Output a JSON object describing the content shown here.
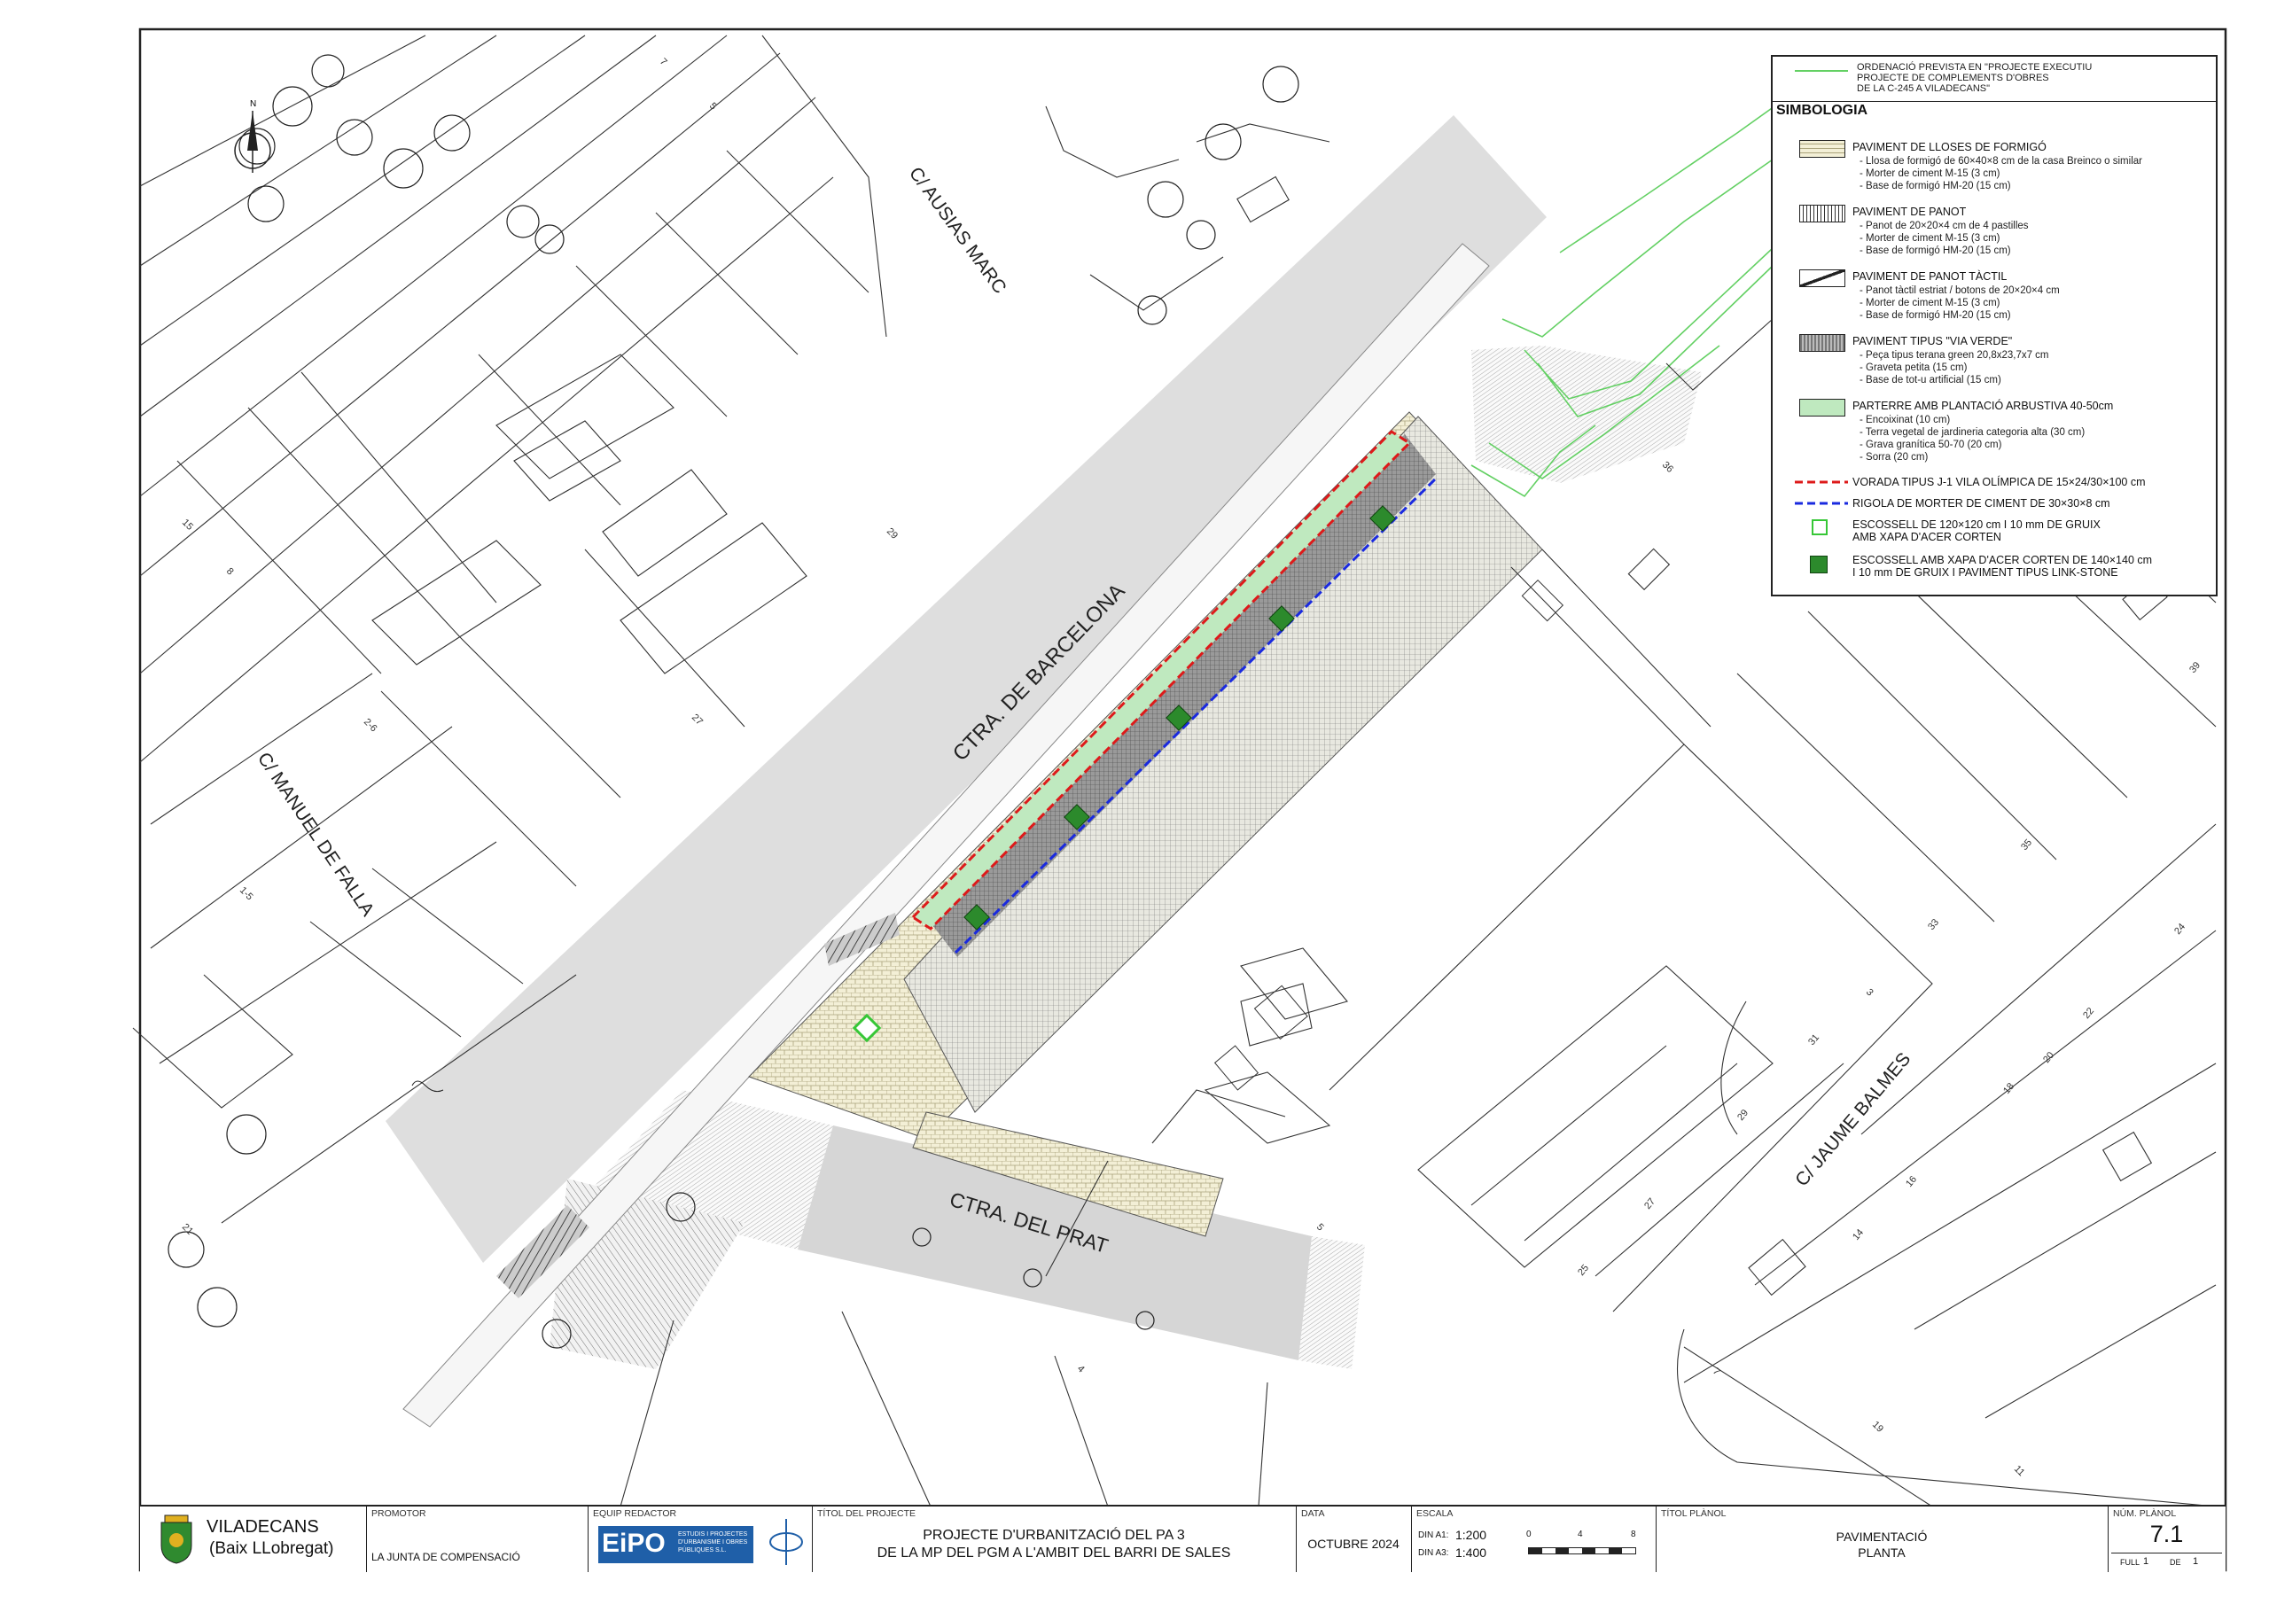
{
  "map": {
    "street_labels": [
      "C/ AUSIAS MARC",
      "CTRA. DE BARCELONA",
      "C/ MANUEL DE FALLA",
      "CTRA. DEL PRAT",
      "C/ JAUME BALMES"
    ],
    "lot_numbers": [
      "7",
      "5",
      "29",
      "15",
      "8",
      "2-6",
      "27",
      "1-5",
      "21",
      "4",
      "36",
      "39",
      "35",
      "33",
      "31",
      "24",
      "22",
      "20",
      "18",
      "16",
      "14",
      "29",
      "27",
      "25",
      "5",
      "3",
      "7",
      "11",
      "19"
    ],
    "north_symbol": "N"
  },
  "legend": {
    "header_note": [
      "ORDENACIÓ PREVISTA EN \"PROJECTE EXECUTIU",
      "PROJECTE DE COMPLEMENTS D'OBRES",
      "DE LA C-245 A VILADECANS\""
    ],
    "title": "SIMBOLOGIA",
    "items": [
      {
        "title": "PAVIMENT DE LLOSES DE FORMIGÓ",
        "details": [
          "- Llosa de formigó de 60×40×8 cm de la casa Breinco o similar",
          "- Morter de ciment M-15 (3 cm)",
          "- Base de formigó HM-20 (15 cm)"
        ],
        "icon": "lloses-swatch"
      },
      {
        "title": "PAVIMENT DE PANOT",
        "details": [
          "- Panot de 20×20×4 cm de 4 pastilles",
          "- Morter de ciment M-15 (3 cm)",
          "- Base de formigó HM-20 (15 cm)"
        ],
        "icon": "panot-swatch"
      },
      {
        "title": "PAVIMENT DE PANOT TÀCTIL",
        "details": [
          "- Panot tàctil estriat / botons de 20×20×4 cm",
          "- Morter de ciment M-15 (3 cm)",
          "- Base de formigó HM-20 (15 cm)"
        ],
        "icon": "tactil-swatch"
      },
      {
        "title": "PAVIMENT TIPUS \"VIA VERDE\"",
        "details": [
          "- Peça tipus terana green 20,8x23,7x7 cm",
          "- Graveta petita (15 cm)",
          "- Base de tot-u artificial (15 cm)"
        ],
        "icon": "via-verde-swatch"
      },
      {
        "title": "PARTERRE AMB PLANTACIÓ ARBUSTIVA 40-50cm",
        "details": [
          "- Encoixinat (10 cm)",
          "- Terra vegetal de jardineria categoria alta (30 cm)",
          "- Grava granítica 50-70 (20 cm)",
          "- Sorra (20 cm)"
        ],
        "icon": "parterre-swatch"
      }
    ],
    "line_items": [
      {
        "title": "VORADA TIPUS J-1 VILA OLÍMPICA DE 15×24/30×100 cm",
        "color": "#dd1a1a"
      },
      {
        "title": "RIGOLA DE MORTER DE CIMENT DE 30×30×8 cm",
        "color": "#1a2adf"
      }
    ],
    "escossells": [
      {
        "lines": [
          "ESCOSSELL DE 120×120 cm I 10 mm DE GRUIX",
          "AMB XAPA D'ACER CORTEN"
        ],
        "icon": "escossell-open-icon"
      },
      {
        "lines": [
          "ESCOSSELL AMB XAPA D'ACER CORTEN DE 140×140 cm",
          "I 10 mm DE GRUIX I PAVIMENT TIPUS LINK-STONE"
        ],
        "icon": "escossell-filled-icon"
      }
    ],
    "colors": {
      "green_line": "#63d063",
      "parterre": "#bfe9bf",
      "red": "#dd1a1a",
      "blue": "#1a2adf",
      "tree_green": "#2c8a2c"
    }
  },
  "title_block": {
    "municipality": "VILADECANS",
    "region": "(Baix LLobregat)",
    "promotor_label": "PROMOTOR",
    "promotor": "LA JUNTA DE COMPENSACIÓ",
    "equip_label": "EQUIP REDACTOR",
    "equip_logo": "EiPO",
    "equip_sub": [
      "ESTUDIS I PROJECTES",
      "D'URBANISME I OBRES",
      "PÚBLIQUES S.L."
    ],
    "project_label": "TÍTOL DEL PROJECTE",
    "project_line1": "PROJECTE D'URBANITZACIÓ DEL PA 3",
    "project_line2": "DE LA MP DEL PGM A L'AMBIT DEL BARRI DE SALES",
    "date_label": "DATA",
    "date": "OCTUBRE 2024",
    "scale_label": "ESCALA",
    "scale_a1_label": "DIN A1:",
    "scale_a1": "1:200",
    "scale_a3_label": "DIN A3:",
    "scale_a3": "1:400",
    "scalebar_ticks": [
      "0",
      "4",
      "8"
    ],
    "plan_label": "TÍTOL PLÀNOL",
    "plan_line1": "PAVIMENTACIÓ",
    "plan_line2": "PLANTA",
    "num_label": "NÚM. PLÀNOL",
    "num": "7.1",
    "full_label": "FULL",
    "full": "1",
    "de_label": "DE",
    "de": "1"
  }
}
